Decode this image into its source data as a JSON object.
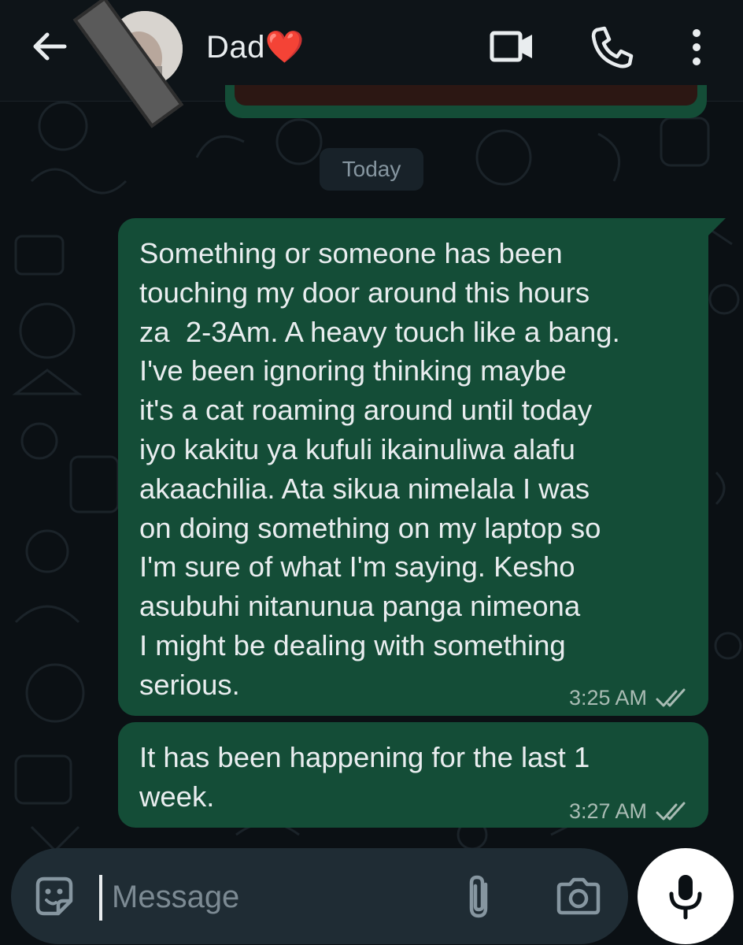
{
  "header": {
    "contact_name": "Dad❤️",
    "icons": [
      "back-arrow-icon",
      "avatar",
      "video-call-icon",
      "voice-call-icon",
      "more-options-icon"
    ]
  },
  "date_divider": "Today",
  "messages": [
    {
      "direction": "outgoing",
      "lines": [
        "Something or someone has been",
        "touching my door around this hours",
        "za  2-3Am. A heavy touch like a bang.",
        "I've been ignoring thinking maybe",
        "it's a cat roaming around until today",
        "iyo kakitu ya kufuli ikainuliwa alafu",
        "akaachilia. Ata sikua nimelala I was",
        "on doing something on my laptop so",
        "I'm sure of what I'm saying. Kesho",
        "asubuhi nitanunua panga nimeona",
        "I might be dealing with something",
        "serious."
      ],
      "time": "3:25 AM",
      "status": "read-double-check"
    },
    {
      "direction": "outgoing",
      "lines": [
        "It has been happening for the last 1",
        "week."
      ],
      "time": "3:27 AM",
      "status": "read-double-check"
    }
  ],
  "composer": {
    "placeholder": "Message",
    "icons": [
      "sticker-icon",
      "attach-icon",
      "camera-icon",
      "mic-icon"
    ]
  },
  "colors": {
    "background": "#0b1014",
    "header": "#0e1418",
    "outgoing_bubble": "#144d37",
    "composer": "#1f2c34",
    "text": "#e9edef"
  }
}
